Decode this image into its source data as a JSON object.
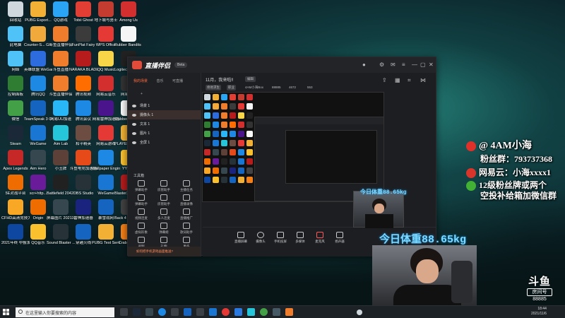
{
  "desktop_icons": [
    {
      "label": "回收站",
      "color": "#cfd8dc"
    },
    {
      "label": "PUBG Esport...",
      "color": "#f2b134"
    },
    {
      "label": "QQ游戏",
      "color": "#2aa4f4"
    },
    {
      "label": "Tobii Ghost",
      "color": "#e33e33"
    },
    {
      "label": "地下城与勇士",
      "color": "#c43b2f"
    },
    {
      "label": "Among Us",
      "color": "#d32f2f"
    },
    {
      "label": "此电脑",
      "color": "#4fc3f7"
    },
    {
      "label": "Counter-S... Global Off...",
      "color": "#f2a93b"
    },
    {
      "label": "斗鱼直播伴侣",
      "color": "#f07d2b"
    },
    {
      "label": "FunPlat Fairy",
      "color": "#3b3b3b"
    },
    {
      "label": "WPS Office",
      "color": "#e53935"
    },
    {
      "label": "Rubber Bandits S...",
      "color": "#f5f5f5"
    },
    {
      "label": "网络",
      "color": "#4fc3f7"
    },
    {
      "label": "英雄联盟 WeGame版",
      "color": "#2d6cdf"
    },
    {
      "label": "斗鱼直播",
      "color": "#f07d2b"
    },
    {
      "label": "NARAKA BLADEPOI...",
      "color": "#b71c1c"
    },
    {
      "label": "QQ Music",
      "color": "#f9d648"
    },
    {
      "label": "Logitech G HUB",
      "color": "#222"
    },
    {
      "label": "控制面板",
      "color": "#2e7d32"
    },
    {
      "label": "腾讯QQ",
      "color": "#1e88e5"
    },
    {
      "label": "斗鱼直播伴侣",
      "color": "#f07d2b"
    },
    {
      "label": "腾讯视频",
      "color": "#ff6d00"
    },
    {
      "label": "网易云音乐",
      "color": "#d32f2f"
    },
    {
      "label": "网易大神",
      "color": "#333"
    },
    {
      "label": "微信",
      "color": "#43a047"
    },
    {
      "label": "TeamSpeak 3 Client",
      "color": "#1565c0"
    },
    {
      "label": "网易UU加速",
      "color": "#29b6f6"
    },
    {
      "label": "腾讯会议",
      "color": "#1e88e5"
    },
    {
      "label": "网易雷神加速器",
      "color": "#4a148c"
    },
    {
      "label": "Rubber Bandits",
      "color": "#fafafa"
    },
    {
      "label": "Steam",
      "color": "#1b2838"
    },
    {
      "label": "WeGame",
      "color": "#1976d2"
    },
    {
      "label": "Aim Lab",
      "color": "#26c6da"
    },
    {
      "label": "和平精英",
      "color": "#6d4c41"
    },
    {
      "label": "网易云游戏",
      "color": "#e53935"
    },
    {
      "label": "PLAYER... BATTLEGR...",
      "color": "#f2b134"
    },
    {
      "label": "Apex Legends",
      "color": "#c62828"
    },
    {
      "label": "Aim Hero",
      "color": "#37474f"
    },
    {
      "label": "小丑牌",
      "color": "#5d4037"
    },
    {
      "label": "斗鱼电竞加速器",
      "color": "#e64a19"
    },
    {
      "label": "Wallpaper Engine",
      "color": "#1e88e5"
    },
    {
      "label": "YY语音",
      "color": "#fbc02d"
    },
    {
      "label": "5E对战平台",
      "color": "#ef6c00"
    },
    {
      "label": "scr+http...",
      "color": "#6a1b9a"
    },
    {
      "label": "Battlefield 2042 Ope...",
      "color": "#212121"
    },
    {
      "label": "OBS Studio",
      "color": "#263238"
    },
    {
      "label": "WeGame",
      "color": "#1976d2"
    },
    {
      "label": "BlasterX Acoustic...",
      "color": "#b71c1c"
    },
    {
      "label": "CFHD高清竞技大区",
      "color": "#f9a825"
    },
    {
      "label": "Origin",
      "color": "#ef6c00"
    },
    {
      "label": "屏幕图片 20211031...",
      "color": "#37474f"
    },
    {
      "label": "雷神加速器",
      "color": "#1a237e"
    },
    {
      "label": "暴雪战网",
      "color": "#1565c0"
    },
    {
      "label": "Back 4 Blood Beta",
      "color": "#424242"
    },
    {
      "label": "2021年终 中报发布",
      "color": "#0d47a1"
    },
    {
      "label": "QQ音乐",
      "color": "#fbc02d"
    },
    {
      "label": "Sound Blaster ...",
      "color": "#263238"
    },
    {
      "label": "穿越火线",
      "color": "#1565c0"
    },
    {
      "label": "PUBG Test Server",
      "color": "#f2b134"
    },
    {
      "label": "Crab Game",
      "color": "#f57f17"
    }
  ],
  "app": {
    "title": "直播伴侣",
    "beta": "Beta",
    "sidebar_tabs": [
      "我的场景",
      "音乐",
      "可直播"
    ],
    "sources": [
      {
        "label": "场景 1",
        "selected": false
      },
      {
        "label": "摄像头 1",
        "selected": true
      },
      {
        "label": "文本 1",
        "selected": false
      },
      {
        "label": "图片 1",
        "selected": false
      },
      {
        "label": "全屏 1",
        "selected": false
      }
    ],
    "tools_title": "工具箱",
    "tools": [
      "弹幕助手",
      "房管助手",
      "主播任务",
      "弹幕助手",
      "房管助手",
      "直播录像",
      "视频连麦",
      "多人连麦",
      "直播推广",
      "虚拟形象",
      "弹幕姬",
      "歌词助手",
      "录制",
      "礼物",
      "更多"
    ],
    "sidebar_notice": "如何把手机游戏画面推送?",
    "live_title": "11月，我来啦!!",
    "edit_label": "编辑",
    "tags": [
      "绝地求生",
      "职业",
      "4AM小海Box",
      "88885",
      "4672",
      "553"
    ],
    "bottom_buttons": [
      "直播屏幕",
      "摄像头",
      "手机投屏",
      "多媒体",
      "麦克风",
      "扬声器"
    ]
  },
  "overlay": {
    "weibo": "@ 4AM小海",
    "fans_group": "粉丝群：793737368",
    "netease": "网易云：小海xxxx1",
    "wechat_note1": "12级粉丝牌或两个",
    "wechat_note2": "空投补给箱加微信群",
    "weight_large": "今日体重88.65kg",
    "weight_small": "今日体重88.65kg"
  },
  "douyu": {
    "logo": "斗鱼",
    "sub": "房间号",
    "room_id": "88885"
  },
  "taskbar": {
    "search_placeholder": "在这里输入你要搜索的内容",
    "time": "18:44",
    "date": "2021/11/6",
    "watermark_time": "2021/11/6"
  }
}
